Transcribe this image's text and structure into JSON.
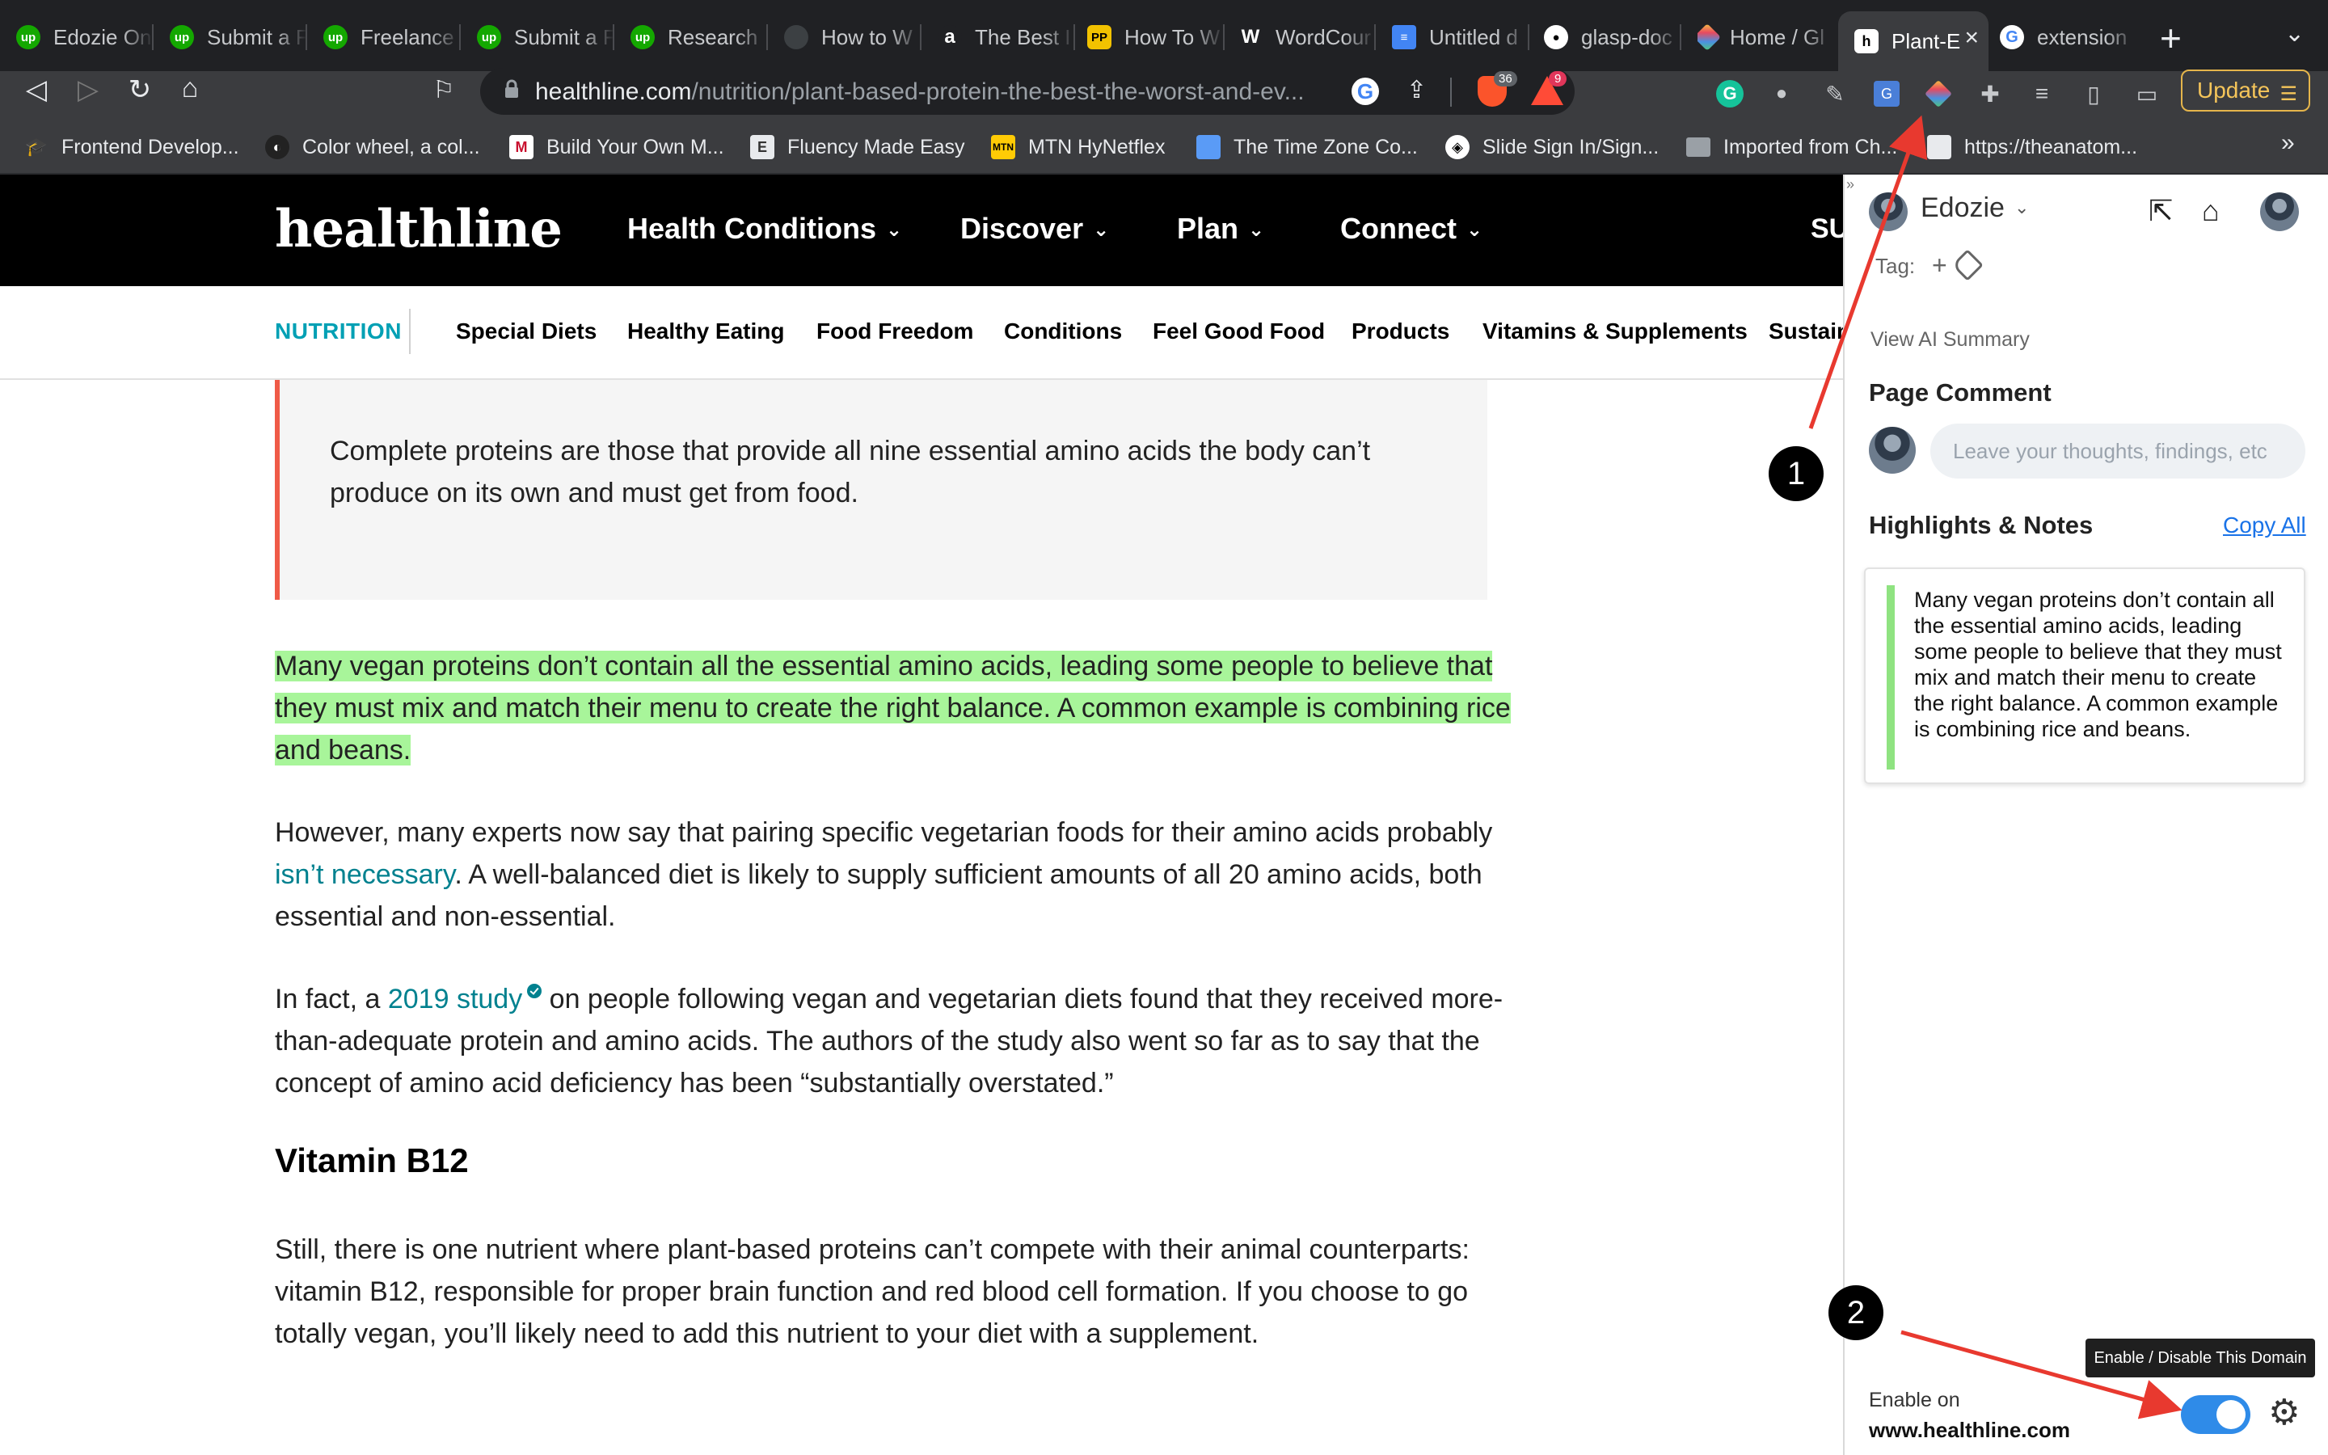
{
  "browser": {
    "tabs": [
      {
        "label": "Edozie On",
        "icon": "upwork-icon",
        "color": "#14a800"
      },
      {
        "label": "Submit a F",
        "icon": "upwork-icon",
        "color": "#14a800"
      },
      {
        "label": "Freelance",
        "icon": "upwork-icon",
        "color": "#14a800"
      },
      {
        "label": "Submit a F",
        "icon": "upwork-icon",
        "color": "#14a800"
      },
      {
        "label": "Research",
        "icon": "upwork-icon",
        "color": "#14a800"
      },
      {
        "label": "How to W",
        "icon": "globe-icon",
        "color": "#3c4043"
      },
      {
        "label": "The Best I",
        "icon": "amazon-icon",
        "color": "#202124"
      },
      {
        "label": "How To W",
        "icon": "pp-icon",
        "color": "#f2c200"
      },
      {
        "label": "WordCour",
        "icon": "w-icon",
        "color": "#202124"
      },
      {
        "label": "Untitled d",
        "icon": "docs-icon",
        "color": "#4285f4"
      },
      {
        "label": "glasp-doc",
        "icon": "github-icon",
        "color": "#202124"
      },
      {
        "label": "Home / Gl",
        "icon": "glasp-icon",
        "color": "#202124"
      },
      {
        "label": "Plant-E",
        "icon": "healthline-icon",
        "color": "#000000"
      },
      {
        "label": "extension",
        "icon": "google-icon",
        "color": "#202124"
      }
    ],
    "address": {
      "domain": "healthline.com",
      "path": "/nutrition/plant-based-protein-the-best-the-worst-and-ev..."
    },
    "brave_badge": "36",
    "rewards_badge": "9",
    "update_label": "Update",
    "bookmarks": [
      {
        "label": "Frontend Develop...",
        "icon": "graduation-cap-icon"
      },
      {
        "label": "Color wheel, a col...",
        "icon": "canva-icon"
      },
      {
        "label": "Build Your Own M...",
        "icon": "m-icon"
      },
      {
        "label": "Fluency Made Easy",
        "icon": "e-icon"
      },
      {
        "label": "MTN HyNetflex",
        "icon": "mtn-icon"
      },
      {
        "label": "The Time Zone Co...",
        "icon": "calendar-icon"
      },
      {
        "label": "Slide Sign In/Sign...",
        "icon": "slide-icon"
      },
      {
        "label": "Imported from Ch...",
        "icon": "folder-icon"
      },
      {
        "label": "https://theanatom...",
        "icon": "page-icon"
      }
    ],
    "bookmarks_more": "»"
  },
  "site": {
    "logo": "healthline",
    "nav": [
      "Health Conditions",
      "Discover",
      "Plan",
      "Connect"
    ],
    "nav_cutoff": "SU",
    "subnav": {
      "section": "NUTRITION",
      "items": [
        "Special Diets",
        "Healthy Eating",
        "Food Freedom",
        "Conditions",
        "Feel Good Food",
        "Products",
        "Vitamins & Supplements",
        "Sustain"
      ]
    }
  },
  "article": {
    "callout": "Complete proteins are those that provide all nine essential amino acids the body can’t produce on its own and must get from food.",
    "highlighted": "Many vegan proteins don’t contain all the essential amino acids, leading some people to believe that they must mix and match their menu to create the right balance. A common example is combining rice and beans.",
    "p2": {
      "a": "However, many experts now say that pairing specific vegetarian foods for their amino acids probably ",
      "link": "isn’t necessary",
      "b": ". A well-balanced diet is likely to supply sufficient amounts of all 20 amino acids, both essential and non-essential."
    },
    "p3": {
      "a": "In fact, a ",
      "link": "2019 study",
      "b": " on people following vegan and vegetarian diets found that they received more-than-adequate protein and amino acids. The authors of the study also went so far as to say that the concept of amino acid deficiency has been “substantially overstated.”"
    },
    "heading": "Vitamin B12",
    "p4": "Still, there is one nutrient where plant-based proteins can’t compete with their animal counterparts: vitamin B12, responsible for proper brain function and red blood cell formation. If you choose to go totally vegan, you’ll likely need to add this nutrient to your diet with a supplement."
  },
  "sidebar": {
    "user": "Edozie",
    "tag_label": "Tag:",
    "tag_add": "+",
    "ai_summary": "View AI Summary",
    "page_comment_title": "Page Comment",
    "comment_placeholder": "Leave your thoughts, findings, etc",
    "highlights_title": "Highlights & Notes",
    "copy_all": "Copy All",
    "highlight_text": "Many vegan proteins don’t contain all the essential amino acids, leading some people to believe that they must mix and match their menu to create the right balance. A common example is combining rice and beans.",
    "highlight_color": "#8fe381",
    "enable_label": "Enable on",
    "enable_domain": "www.healthline.com",
    "toggle_on": true,
    "tooltip": "Enable / Disable This Domain"
  },
  "annotations": {
    "badge1": "1",
    "badge2": "2",
    "arrow_color": "#e8392f"
  }
}
